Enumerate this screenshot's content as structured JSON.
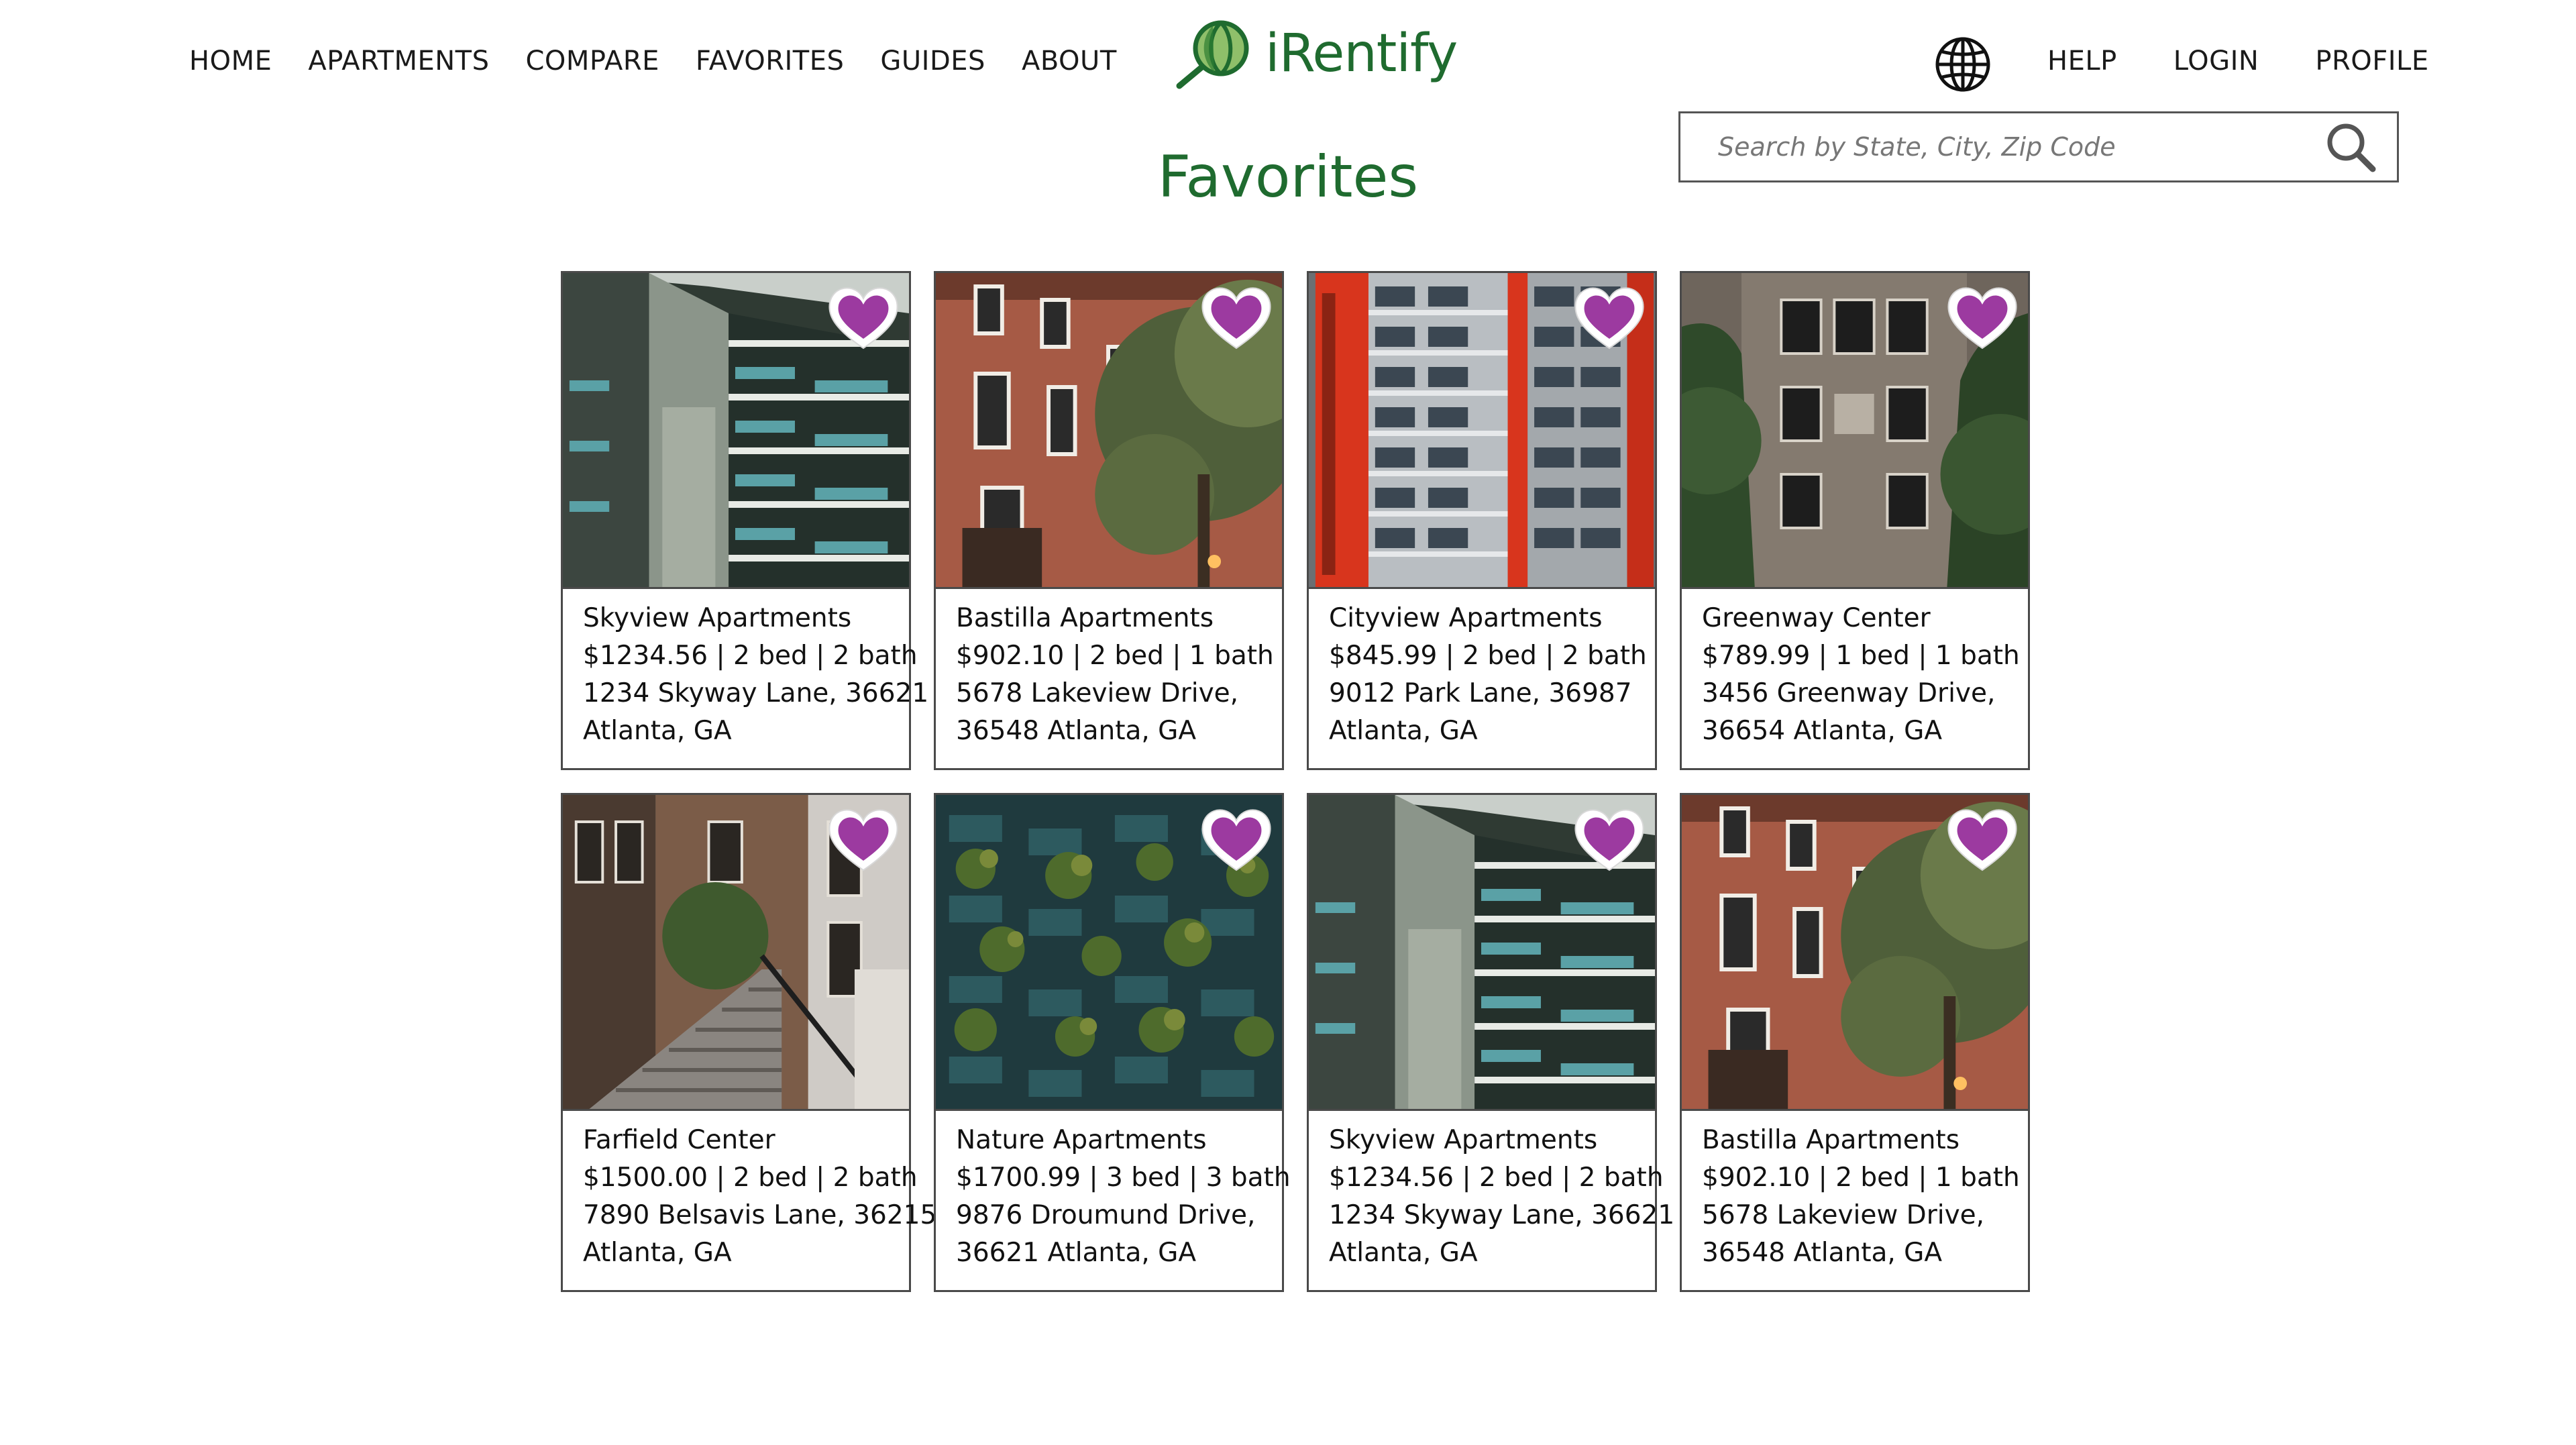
{
  "nav": {
    "left": [
      "HOME",
      "APARTMENTS",
      "COMPARE",
      "FAVORITES",
      "GUIDES",
      "ABOUT"
    ],
    "right": [
      "HELP",
      "LOGIN",
      "PROFILE"
    ]
  },
  "brand": {
    "name": "iRentify",
    "color": "#1f6b2f"
  },
  "search": {
    "placeholder": "Search by State, City, Zip Code"
  },
  "page": {
    "title": "Favorites"
  },
  "colors": {
    "heart": "#9c3aa0",
    "accent": "#1f6b2f"
  },
  "listings": [
    {
      "name": "Skyview Apartments",
      "details": "$1234.56 | 2 bed | 2 bath",
      "line1": "1234 Skyway Lane, 36621",
      "line2": "Atlanta, GA",
      "photo": "modern-balconies"
    },
    {
      "name": "Bastilla Apartments",
      "details": "$902.10 | 2 bed | 1 bath",
      "line1": "5678 Lakeview Drive,",
      "line2": "36548 Atlanta, GA",
      "photo": "brick-townhouse"
    },
    {
      "name": "Cityview Apartments",
      "details": "$845.99 | 2 bed | 2 bath",
      "line1": "9012 Park Lane, 36987",
      "line2": "Atlanta, GA",
      "photo": "red-tower"
    },
    {
      "name": "Greenway Center",
      "details": "$789.99 | 1 bed | 1 bath",
      "line1": "3456 Greenway Drive,",
      "line2": "36654 Atlanta, GA",
      "photo": "stone-building-trees"
    },
    {
      "name": "Farfield Center",
      "details": "$1500.00 | 2 bed | 2 bath",
      "line1": "7890 Belsavis Lane, 36215",
      "line2": "Atlanta, GA",
      "photo": "brownstone-stairs"
    },
    {
      "name": "Nature Apartments",
      "details": "$1700.99 | 3 bed | 3 bath",
      "line1": "9876 Droumund Drive,",
      "line2": "36621 Atlanta, GA",
      "photo": "vertical-forest"
    },
    {
      "name": "Skyview Apartments",
      "details": "$1234.56 | 2 bed | 2 bath",
      "line1": "1234 Skyway Lane, 36621",
      "line2": "Atlanta, GA",
      "photo": "modern-balconies"
    },
    {
      "name": "Bastilla Apartments",
      "details": "$902.10 | 2 bed | 1 bath",
      "line1": "5678 Lakeview Drive,",
      "line2": "36548 Atlanta, GA",
      "photo": "brick-townhouse"
    }
  ]
}
